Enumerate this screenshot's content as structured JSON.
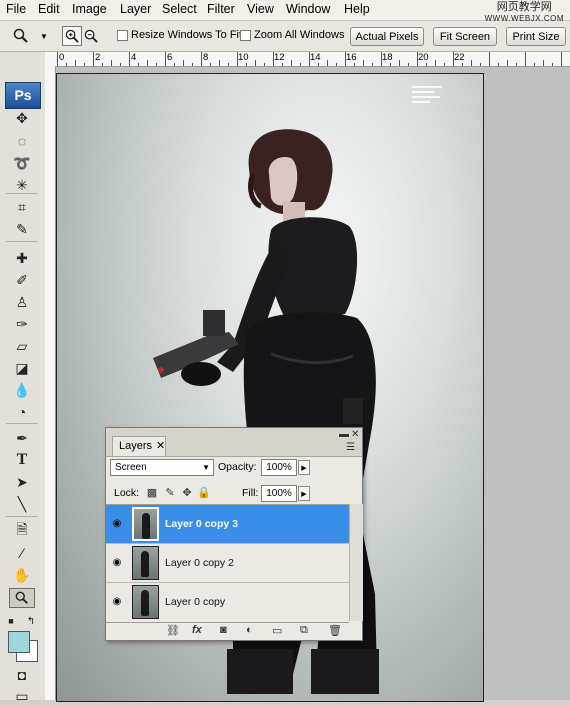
{
  "menu": [
    "File",
    "Edit",
    "Image",
    "Layer",
    "Select",
    "Filter",
    "View",
    "Window",
    "Help"
  ],
  "watermark": {
    "line1": "网页教学网",
    "line2": "WWW.WEBJX.COM"
  },
  "options_bar": {
    "resize_windows_label": "Resize Windows To Fit",
    "zoom_all_label": "Zoom All Windows",
    "actual_pixels": "Actual Pixels",
    "fit_screen": "Fit Screen",
    "print_size": "Print Size"
  },
  "ruler": {
    "labels": [
      "0",
      "2",
      "4",
      "6",
      "8",
      "10",
      "12",
      "14",
      "16",
      "18",
      "20",
      "22"
    ]
  },
  "toolbox": {
    "logo": "Ps"
  },
  "layers_panel": {
    "tab_label": "Layers",
    "blend_mode": "Screen",
    "opacity_label": "Opacity:",
    "opacity_value": "100%",
    "lock_label": "Lock:",
    "fill_label": "Fill:",
    "fill_value": "100%",
    "layers": [
      {
        "name": "Layer 0 copy 3",
        "selected": true
      },
      {
        "name": "Layer 0 copy 2",
        "selected": false
      },
      {
        "name": "Layer 0 copy",
        "selected": false
      }
    ]
  }
}
